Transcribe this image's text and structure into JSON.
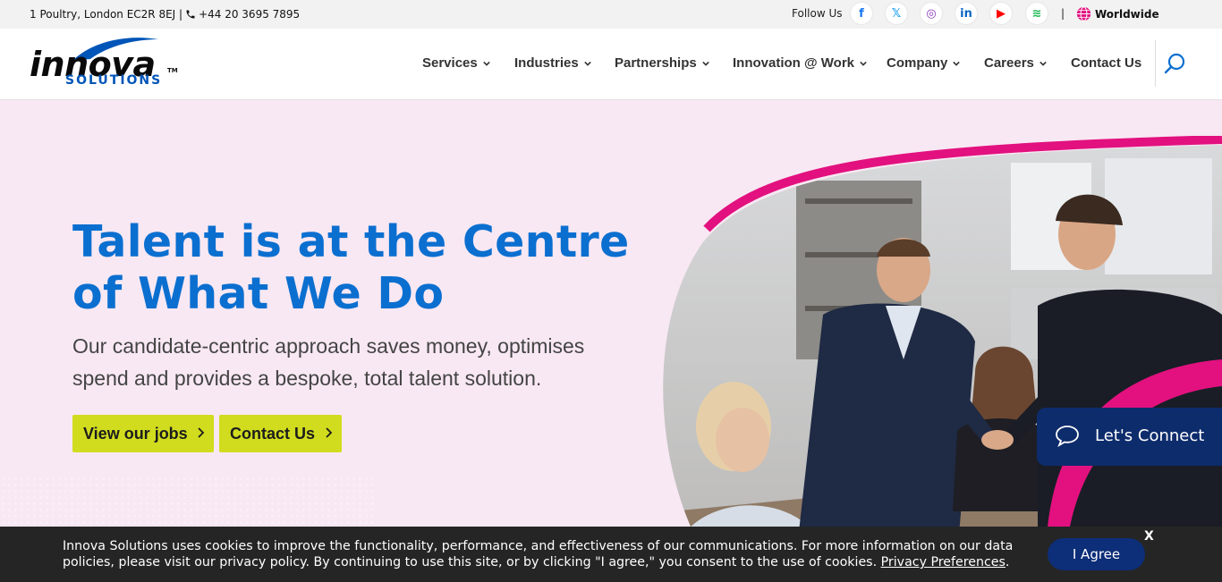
{
  "topbar": {
    "address": "1 Poultry, London EC2R 8EJ |",
    "phone": "+44 20 3695 7895",
    "follow_label": "Follow Us",
    "social": [
      {
        "name": "facebook-icon",
        "glyph": "f",
        "color": "#1877f2"
      },
      {
        "name": "x-twitter-icon",
        "glyph": "𝕏",
        "color": "#1da1f2"
      },
      {
        "name": "instagram-icon",
        "glyph": "◎",
        "color": "#8a3ab9"
      },
      {
        "name": "linkedin-icon",
        "glyph": "in",
        "color": "#0a66c2"
      },
      {
        "name": "youtube-icon",
        "glyph": "▶",
        "color": "#ff0000"
      },
      {
        "name": "spotify-icon",
        "glyph": "≋",
        "color": "#1db954"
      }
    ],
    "separator": "|",
    "region": "Worldwide"
  },
  "header": {
    "logo_main": "innova",
    "logo_sub": "SOLUTIONS",
    "logo_tm": "TM",
    "nav": [
      {
        "label": "Services",
        "has_dropdown": true
      },
      {
        "label": "Industries",
        "has_dropdown": true
      },
      {
        "label": "Partnerships",
        "has_dropdown": true
      },
      {
        "label": "Innovation @ Work",
        "has_dropdown": true
      },
      {
        "label": "Company",
        "has_dropdown": true
      },
      {
        "label": "Careers",
        "has_dropdown": true
      },
      {
        "label": "Contact Us",
        "has_dropdown": false
      }
    ]
  },
  "hero": {
    "title": "Talent is at the Centre of What We Do",
    "subtitle": "Our candidate-centric approach saves money, optimises spend and provides a bespoke, total talent solution.",
    "button_primary": "View our jobs",
    "button_secondary": "Contact Us"
  },
  "chat": {
    "label": "Let's Connect"
  },
  "cookie": {
    "text": "Innova Solutions uses cookies to improve the functionality, performance, and effectiveness of our communications. For more information on our data policies, please visit our privacy policy. By continuing to use this site, or by clicking \"I agree,\" you consent to the use of cookies. ",
    "link": "Privacy Preferences",
    "trailing": ".",
    "agree": "I Agree",
    "close": "X"
  },
  "colors": {
    "brand_blue": "#0b6fd0",
    "navy": "#0d2c6c",
    "lime": "#d1dc1f",
    "magenta": "#e2117f",
    "hero_bg": "#f8e8f3"
  }
}
